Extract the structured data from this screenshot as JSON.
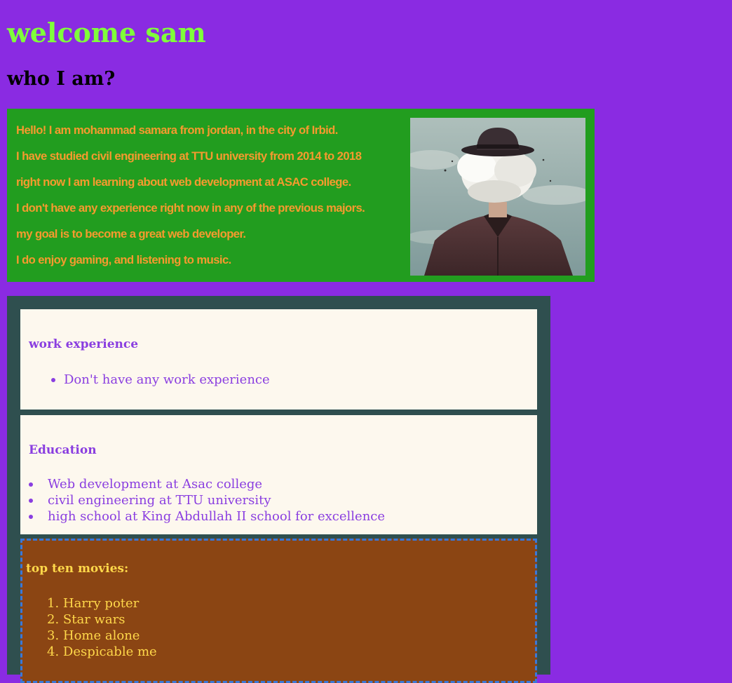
{
  "header": {
    "title": "welcome sam",
    "subtitle": "who I am?"
  },
  "intro": {
    "lines": [
      "Hello! I am mohammad samara from jordan, in the city of Irbid.",
      "I have studied civil engineering at TTU university from 2014 to 2018",
      "right now I am learning about web development at ASAC college.",
      "I don't have any experience right now in any of the previous majors.",
      "my goal is to become a great web developer.",
      "I do enjoy gaming, and listening to music."
    ],
    "photo_icon": "portrait-man-bowler-hat-cloud-head"
  },
  "work": {
    "title": "work experience",
    "items": [
      "Don't have any work experience"
    ]
  },
  "education": {
    "title": "Education",
    "items": [
      "Web development at Asac college",
      "civil engineering at TTU university",
      "high school at King Abdullah II school for excellence"
    ]
  },
  "movies": {
    "title": "top ten movies:",
    "items": [
      "1. Harry poter",
      "2. Star wars",
      "3. Home alone",
      "4. Despicable me"
    ]
  },
  "colors": {
    "page_background": "#8a2be2",
    "title": "#7fff3a",
    "intro_background": "#229d1f",
    "intro_text": "#f59a2e",
    "panel_background": "#2f4f4f",
    "card_background": "#fdf8ee",
    "card_text": "#8a3ee0",
    "movies_background": "#8b4513",
    "movies_text": "#ffd84a",
    "movies_border": "#3a78d8"
  }
}
